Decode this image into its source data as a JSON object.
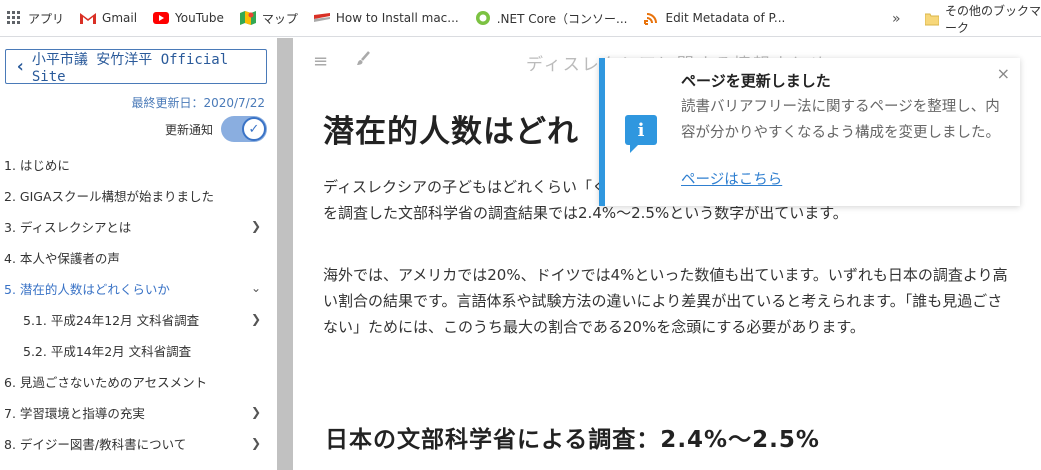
{
  "bookmarks": {
    "items": [
      {
        "label": "アプリ",
        "icon": "apps-grid-icon"
      },
      {
        "label": "Gmail",
        "icon": "gmail-icon"
      },
      {
        "label": "YouTube",
        "icon": "youtube-icon"
      },
      {
        "label": "マップ",
        "icon": "maps-icon"
      },
      {
        "label": "How to Install mac...",
        "icon": "bookmark-favicon-icon"
      },
      {
        "label": ".NET Core（コンソー...",
        "icon": "bookmark-favicon-icon"
      },
      {
        "label": "Edit Metadata of P...",
        "icon": "bookmark-favicon-icon"
      }
    ],
    "more": "»",
    "other": "その他のブックマーク"
  },
  "sidebar": {
    "back_label": "小平市議 安竹洋平 Official Site",
    "updated": "最終更新日：2020/7/22",
    "notify_label": "更新通知",
    "notify_on": true,
    "toc": [
      {
        "label": "1. はじめに",
        "arrow": "",
        "sub": false,
        "active": false
      },
      {
        "label": "2. GIGAスクール構想が始まりました",
        "arrow": "",
        "sub": false,
        "active": false
      },
      {
        "label": "3. ディスレクシアとは",
        "arrow": "❯",
        "sub": false,
        "active": false
      },
      {
        "label": "4. 本人や保護者の声",
        "arrow": "",
        "sub": false,
        "active": false
      },
      {
        "label": "5. 潜在的人数はどれくらいか",
        "arrow": "⌄",
        "sub": false,
        "active": true
      },
      {
        "label": "5.1. 平成24年12月 文科省調査",
        "arrow": "❯",
        "sub": true,
        "active": false
      },
      {
        "label": "5.2. 平成14年2月 文科省調査",
        "arrow": "",
        "sub": true,
        "active": false
      },
      {
        "label": "6. 見過ごさないためのアセスメント",
        "arrow": "",
        "sub": false,
        "active": false
      },
      {
        "label": "7. 学習環境と指導の充実",
        "arrow": "❯",
        "sub": false,
        "active": false
      },
      {
        "label": "8. デイジー図書/教科書について",
        "arrow": "❯",
        "sub": false,
        "active": false
      }
    ]
  },
  "main": {
    "page_heading": "ディスレクシアに関する情報まとめ",
    "h1": "潜在的人数はどれ",
    "p1": "ディスレクシアの子どもはどれくらい「く」に著しい困難を示す児童生徒を含めて、発達障害の状況を調査した文部科学省の調査結果では2.4%～2.5%という数字が出ています。",
    "p2": "海外では、アメリカでは20%、ドイツでは4%といった数値も出ています。いずれも日本の調査より高い割合の結果です。言語体系や試験方法の違いにより差異が出ていると考えられます。「誰も見過ごさない」ためには、このうち最大の割合である20%を念頭にする必要があります。",
    "h2": "日本の文部科学省による調査：2.4%～2.5%"
  },
  "toast": {
    "title": "ページを更新しました",
    "message": "読書バリアフリー法に関するページを整理し、内容が分かりやすくなるよう構成を変更しました。",
    "link": "ページはこちら",
    "close": "×",
    "accent": "#2f97df"
  }
}
